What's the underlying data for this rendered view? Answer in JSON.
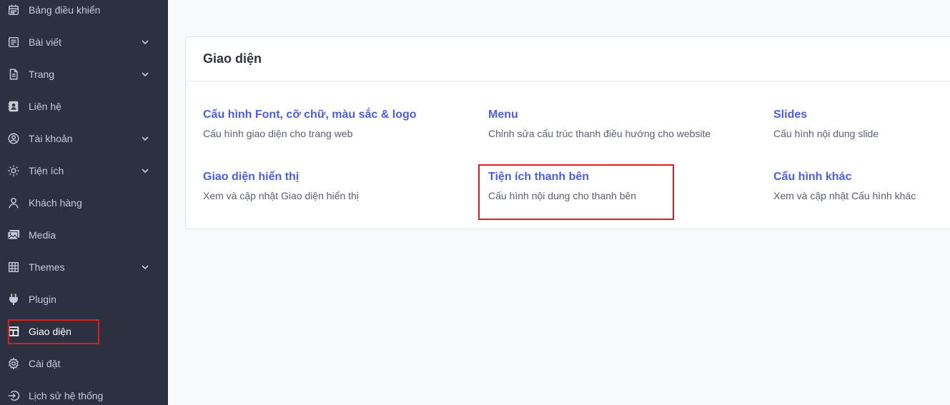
{
  "sidebar": {
    "items": [
      {
        "label": "Bảng điều khiển",
        "icon": "calendar-icon",
        "has_submenu": false
      },
      {
        "label": "Bài viết",
        "icon": "article-icon",
        "has_submenu": true
      },
      {
        "label": "Trang",
        "icon": "page-icon",
        "has_submenu": true
      },
      {
        "label": "Liên hệ",
        "icon": "contact-card-icon",
        "has_submenu": false
      },
      {
        "label": "Tài khoản",
        "icon": "user-circle-icon",
        "has_submenu": true
      },
      {
        "label": "Tiện ích",
        "icon": "sun-icon",
        "has_submenu": true
      },
      {
        "label": "Khách hàng",
        "icon": "user-icon",
        "has_submenu": false
      },
      {
        "label": "Media",
        "icon": "image-gallery-icon",
        "has_submenu": false
      },
      {
        "label": "Themes",
        "icon": "grid-icon",
        "has_submenu": true
      },
      {
        "label": "Plugin",
        "icon": "plug-icon",
        "has_submenu": false
      },
      {
        "label": "Giao diện",
        "icon": "layout-icon",
        "has_submenu": false,
        "active": true
      },
      {
        "label": "Cài đặt",
        "icon": "gear-icon",
        "has_submenu": false
      },
      {
        "label": "Lịch sử hệ thống",
        "icon": "sign-in-icon",
        "has_submenu": false
      }
    ]
  },
  "main": {
    "card_title": "Giao diện",
    "options": [
      {
        "title": "Cấu hình Font, cỡ chữ, màu sắc & logo",
        "desc": "Cấu hình giao diện cho trang web"
      },
      {
        "title": "Menu",
        "desc": "Chỉnh sửa cấu trúc thanh điều hướng cho website"
      },
      {
        "title": "Slides",
        "desc": "Cấu hình nội dung slide"
      },
      {
        "title": "Giao diện hiển thị",
        "desc": "Xem và cập nhật Giao diện hiển thị"
      },
      {
        "title": "Tiện ích thanh bên",
        "desc": "Cấu hình nội dung cho thanh bên"
      },
      {
        "title": "Cấu hình khác",
        "desc": "Xem và cập nhật Cấu hình khác"
      }
    ]
  },
  "colors": {
    "sidebar_bg": "#2c3040",
    "link": "#4e5fd6",
    "highlight": "#e11a1a"
  }
}
